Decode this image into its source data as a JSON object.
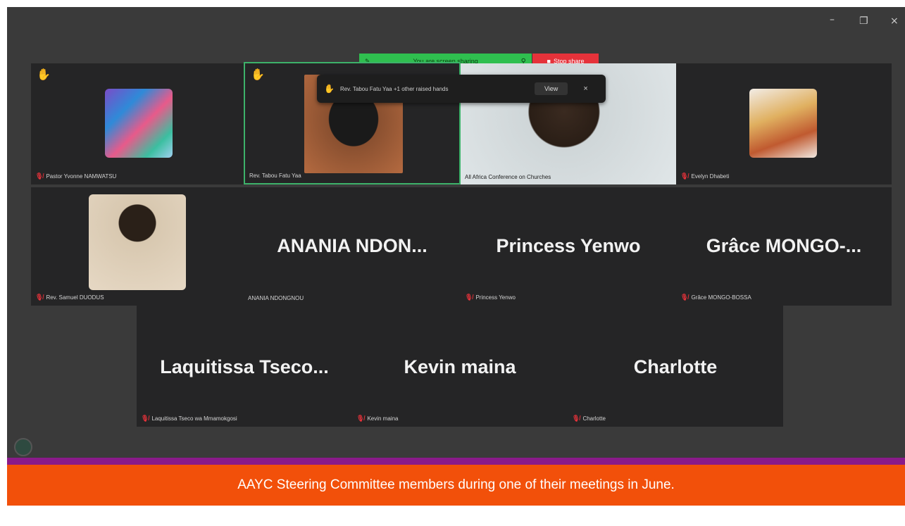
{
  "window": {
    "controls": {
      "minimize": "–",
      "restore": "❐",
      "close": "×"
    }
  },
  "share_bar": {
    "status_text": "You are screen sharing",
    "stop_label": "Stop share"
  },
  "notification": {
    "text": "Rev. Tabou Fatu Yaa +1 other raised hands",
    "view_label": "View",
    "close_label": "×"
  },
  "participants": [
    {
      "display_name": "Pastor Yvonne NAMWATSU",
      "muted": true,
      "hand_raised": true,
      "has_video": false,
      "has_avatar": true
    },
    {
      "display_name": "Rev. Tabou Fatu Yaa",
      "muted": false,
      "hand_raised": true,
      "has_video": true,
      "active_speaker": true
    },
    {
      "display_name": "All Africa Conference on Churches",
      "muted": false,
      "hand_raised": false,
      "has_video": true
    },
    {
      "display_name": "Evelyn Dhabeti",
      "muted": true,
      "hand_raised": false,
      "has_video": false,
      "has_avatar": true
    },
    {
      "display_name": "Rev. Samuel DUODUS",
      "muted": true,
      "hand_raised": false,
      "has_video": false,
      "has_avatar": true
    },
    {
      "display_name": "ANANIA NDONGNOU",
      "big_name": "ANANIA  NDON...",
      "muted": false,
      "hand_raised": false
    },
    {
      "display_name": "Princess Yenwo",
      "big_name": "Princess Yenwo",
      "muted": true,
      "hand_raised": false
    },
    {
      "display_name": "Grâce MONGO-BOSSA",
      "big_name": "Grâce  MONGO-...",
      "muted": true,
      "hand_raised": false
    },
    {
      "display_name": "Laquitissa Tseco wa Mmamokgosi",
      "big_name": "Laquitissa  Tseco...",
      "muted": true,
      "hand_raised": false
    },
    {
      "display_name": "Kevin maina",
      "big_name": "Kevin maina",
      "muted": true,
      "hand_raised": false
    },
    {
      "display_name": "Charlotte",
      "big_name": "Charlotte",
      "muted": true,
      "hand_raised": false
    }
  ],
  "icons": {
    "hand": "raised-hand-icon",
    "mic_off": "mic-off-icon"
  },
  "colors": {
    "share_green": "#2fbf4f",
    "stop_red": "#e5323a",
    "active_border": "#3db26a",
    "caption_bg": "#f2500a",
    "caption_stripe": "#8a1a8a"
  },
  "caption": "AAYC Steering Committee members during one of their meetings in June."
}
